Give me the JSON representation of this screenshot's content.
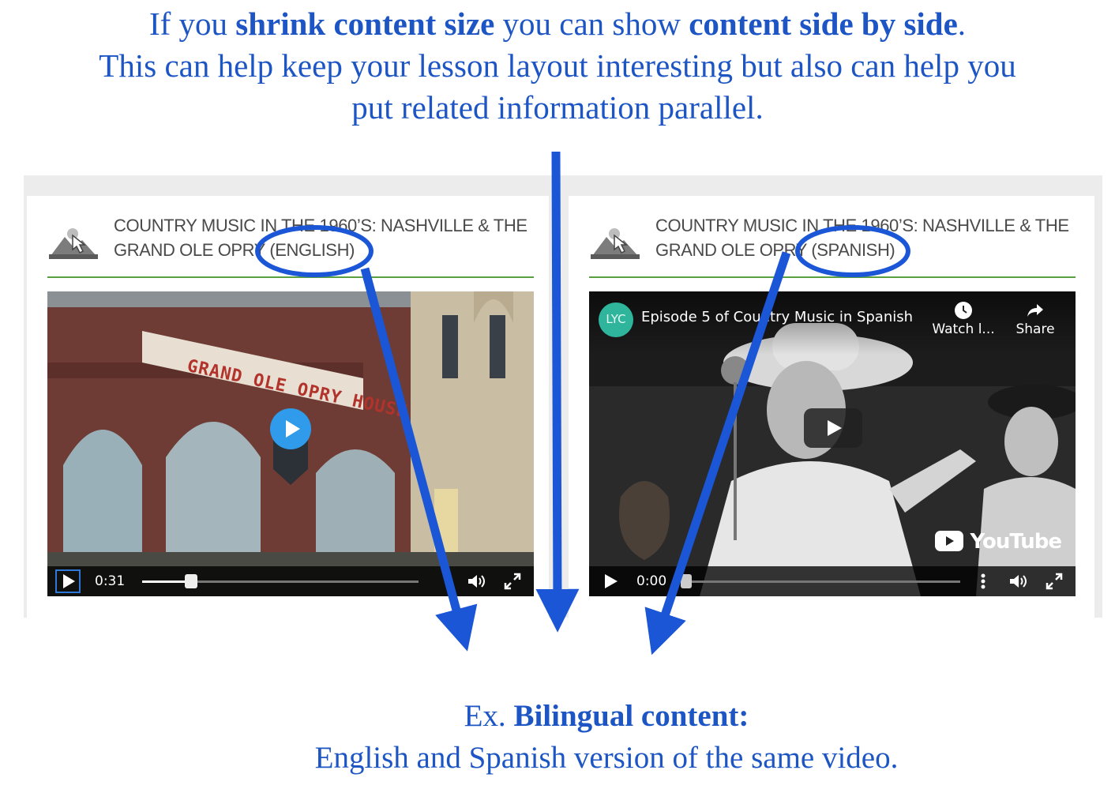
{
  "top_caption": {
    "t1": "If you ",
    "b1": "shrink content size",
    "t2": " you can show ",
    "b2": "content side by side",
    "t3": ".",
    "line2": "This can help keep your lesson layout interesting but also can help you",
    "line3": "put related information parallel."
  },
  "bottom_caption": {
    "prefix": "Ex. ",
    "bold": "Bilingual content:",
    "line2": "English and Spanish version of the same video."
  },
  "cards": [
    {
      "title_line1": "COUNTRY MUSIC IN THE 1960’S: NASHVILLE & THE",
      "title_line2": "GRAND OLE OPRY (ENGLISH)",
      "video": {
        "sign_text": "GRAND OLE OPRY HOUSE",
        "time": "0:31",
        "progress": 0.17
      }
    },
    {
      "title_line1": "COUNTRY MUSIC IN THE 1960’S: NASHVILLE & THE",
      "title_line2": "GRAND OLE OPRY (SPANISH)",
      "video": {
        "channel_badge": "LYC",
        "title": "Episode 5 of Country Music in Spanish",
        "watch_later": "Watch l...",
        "share": "Share",
        "brand": "YouTube",
        "time": "0:00",
        "progress": 0.0
      }
    }
  ],
  "colors": {
    "caption_blue": "#1d56c4",
    "arrow_blue": "#1a56d6",
    "divider_green": "#5aa040",
    "play_blue": "#2f9bea"
  }
}
